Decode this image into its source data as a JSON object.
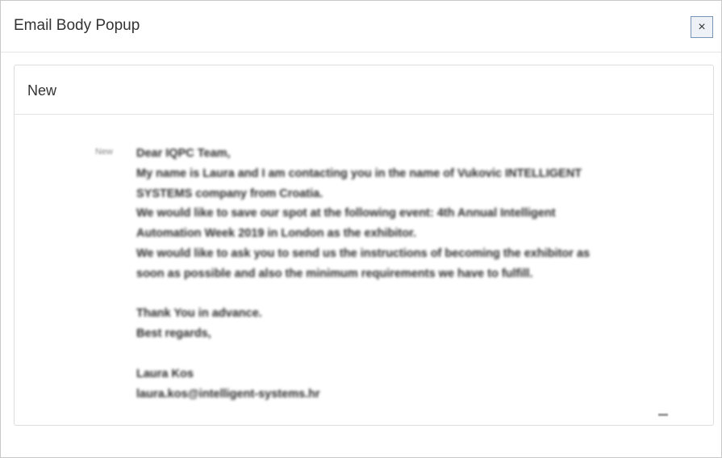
{
  "modal": {
    "title": "Email Body Popup",
    "close_label": "×"
  },
  "panel": {
    "title": "New"
  },
  "email": {
    "status": "New",
    "lines": [
      "Dear IQPC Team,",
      "My name is Laura and I am contacting you in the name of Vukovic INTELLIGENT",
      "SYSTEMS company from Croatia.",
      "We would like to save our spot at the following event: 4th Annual Intelligent",
      "Automation Week 2019 in London as the exhibitor.",
      "We would like to ask you to send us the instructions of becoming the exhibitor as",
      "soon as possible and also the minimum requirements we have to fulfill.",
      "",
      "Thank You in advance.",
      "Best regards,",
      "",
      "Laura Kos",
      "laura.kos@intelligent-systems.hr"
    ]
  },
  "colors": {
    "close_border": "#7a94b8",
    "backdrop_accent": "#3a5fa8"
  }
}
